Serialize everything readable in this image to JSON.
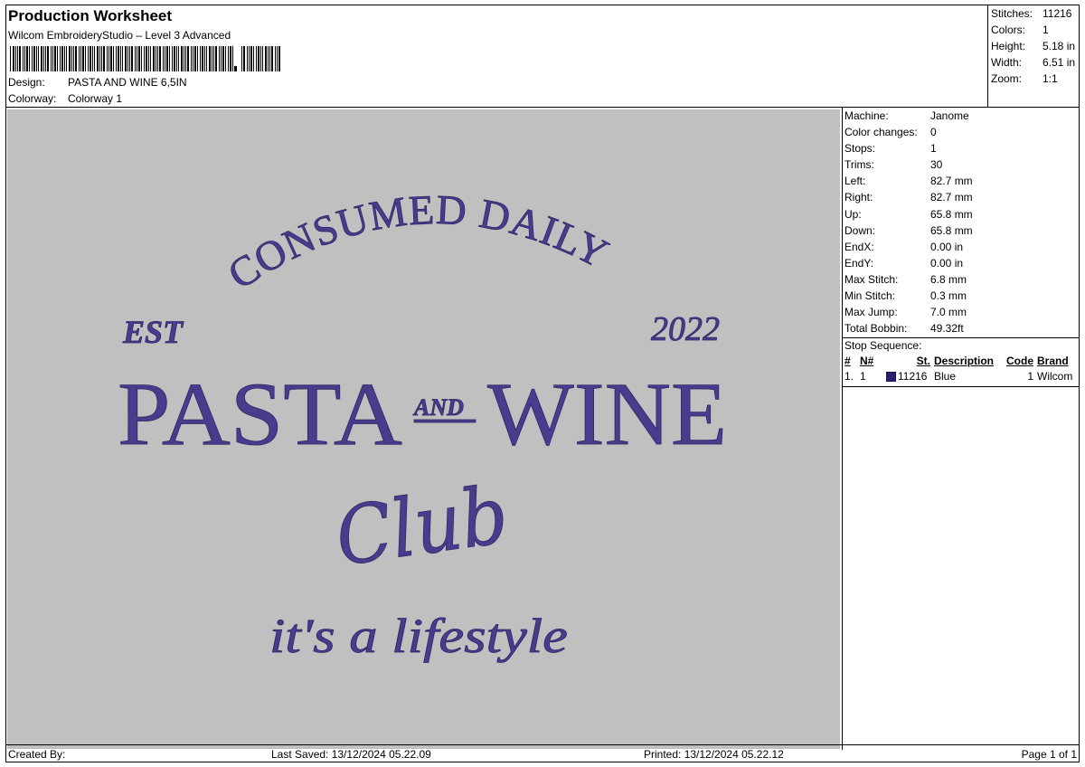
{
  "header": {
    "title": "Production Worksheet",
    "subtitle": "Wilcom EmbroideryStudio – Level 3 Advanced",
    "design_label": "Design:",
    "design_value": "PASTA AND WINE 6,5IN",
    "colorway_label": "Colorway:",
    "colorway_value": "Colorway 1"
  },
  "stats": [
    {
      "label": "Stitches:",
      "value": "11216"
    },
    {
      "label": "Colors:",
      "value": "1"
    },
    {
      "label": "Height:",
      "value": "5.18 in"
    },
    {
      "label": "Width:",
      "value": "6.51 in"
    },
    {
      "label": "Zoom:",
      "value": "1:1"
    }
  ],
  "info": [
    {
      "label": "Machine:",
      "value": "Janome"
    },
    {
      "label": "Color changes:",
      "value": "0"
    },
    {
      "label": "Stops:",
      "value": "1"
    },
    {
      "label": "Trims:",
      "value": "30"
    },
    {
      "label": "Left:",
      "value": "82.7 mm"
    },
    {
      "label": "Right:",
      "value": "82.7 mm"
    },
    {
      "label": "Up:",
      "value": "65.8 mm"
    },
    {
      "label": "Down:",
      "value": "65.8 mm"
    },
    {
      "label": "EndX:",
      "value": "0.00 in"
    },
    {
      "label": "EndY:",
      "value": "0.00 in"
    },
    {
      "label": "Max Stitch:",
      "value": "6.8 mm"
    },
    {
      "label": "Min Stitch:",
      "value": "0.3 mm"
    },
    {
      "label": "Max Jump:",
      "value": "7.0 mm"
    },
    {
      "label": "Total Bobbin:",
      "value": "49.32ft"
    }
  ],
  "stop_sequence": {
    "title": "Stop Sequence:",
    "columns": [
      "#",
      "N#",
      "St.",
      "Description",
      "Code",
      "Brand"
    ],
    "rows": [
      {
        "idx": "1.",
        "n": "1",
        "stitches": "11216",
        "description": "Blue",
        "code": "1",
        "brand": "Wilcom",
        "color": "#2a1f6e"
      }
    ]
  },
  "design": {
    "thread_color": "#4a3c8c",
    "background_color": "#c0c0c0",
    "arc_text": "CONSUMED DAILY",
    "est": "EST",
    "year": "2022",
    "word_left": "PASTA",
    "word_and": "AND",
    "word_right": "WINE",
    "script": "Club",
    "tagline": "it's a lifestyle"
  },
  "footer": {
    "created_by": "Created By:",
    "last_saved": "Last Saved: 13/12/2024 05.22.09",
    "printed": "Printed: 13/12/2024 05.22.12",
    "page": "Page 1 of 1"
  }
}
